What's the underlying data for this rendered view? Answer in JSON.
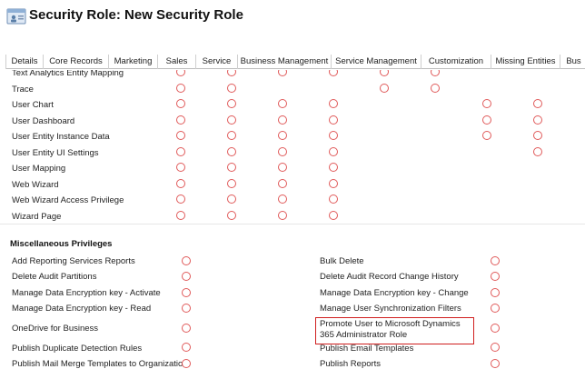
{
  "header": {
    "title": "Security Role: New Security Role",
    "icon": "security-role-icon"
  },
  "tabs": [
    {
      "label": "Details",
      "name": "tab-details"
    },
    {
      "label": "Core Records",
      "name": "tab-core-records"
    },
    {
      "label": "Marketing",
      "name": "tab-marketing"
    },
    {
      "label": "Sales",
      "name": "tab-sales"
    },
    {
      "label": "Service",
      "name": "tab-service"
    },
    {
      "label": "Business Management",
      "name": "tab-business-management"
    },
    {
      "label": "Service Management",
      "name": "tab-service-management"
    },
    {
      "label": "Customization",
      "name": "tab-customization"
    },
    {
      "label": "Missing Entities",
      "name": "tab-missing-entities"
    },
    {
      "label": "Bus",
      "name": "tab-business-process-flows"
    }
  ],
  "entities": [
    {
      "label": "Text Analytics Entity Mapping",
      "privileges": [
        1,
        1,
        1,
        1,
        1,
        1,
        0,
        0
      ]
    },
    {
      "label": "Trace",
      "privileges": [
        1,
        1,
        0,
        0,
        1,
        1,
        0,
        0
      ]
    },
    {
      "label": "User Chart",
      "privileges": [
        1,
        1,
        1,
        1,
        0,
        0,
        1,
        1
      ]
    },
    {
      "label": "User Dashboard",
      "privileges": [
        1,
        1,
        1,
        1,
        0,
        0,
        1,
        1
      ]
    },
    {
      "label": "User Entity Instance Data",
      "privileges": [
        1,
        1,
        1,
        1,
        0,
        0,
        1,
        1
      ]
    },
    {
      "label": "User Entity UI Settings",
      "privileges": [
        1,
        1,
        1,
        1,
        0,
        0,
        0,
        1
      ]
    },
    {
      "label": "User Mapping",
      "privileges": [
        1,
        1,
        1,
        1,
        0,
        0,
        0,
        0
      ]
    },
    {
      "label": "Web Wizard",
      "privileges": [
        1,
        1,
        1,
        1,
        0,
        0,
        0,
        0
      ]
    },
    {
      "label": "Web Wizard Access Privilege",
      "privileges": [
        1,
        1,
        1,
        1,
        0,
        0,
        0,
        0
      ]
    },
    {
      "label": "Wizard Page",
      "privileges": [
        1,
        1,
        1,
        1,
        0,
        0,
        0,
        0
      ]
    }
  ],
  "misc": {
    "title": "Miscellaneous Privileges",
    "left": [
      "Add Reporting Services Reports",
      "Delete Audit Partitions",
      "Manage Data Encryption key - Activate",
      "Manage Data Encryption key - Read",
      "OneDrive for Business",
      "Publish Duplicate Detection Rules",
      "Publish Mail Merge Templates to Organization"
    ],
    "right": [
      "Bulk Delete",
      "Delete Audit Record Change History",
      "Manage Data Encryption key - Change",
      "Manage User Synchronization Filters",
      "Promote User to Microsoft Dynamics 365 Administrator Role",
      "Publish Email Templates",
      "Publish Reports"
    ],
    "highlighted_index": 4
  },
  "colors": {
    "circle": "#e05a5a",
    "highlight": "#d01f1f"
  }
}
